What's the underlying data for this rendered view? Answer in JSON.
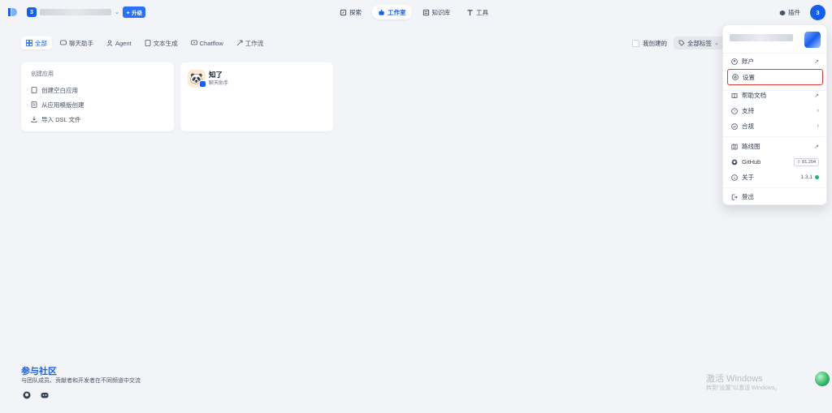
{
  "header": {
    "workspace_badge": "3",
    "upgrade_label": "升级",
    "nav": [
      {
        "label": "探索",
        "icon": "explore-icon"
      },
      {
        "label": "工作室",
        "icon": "studio-icon",
        "active": true
      },
      {
        "label": "知识库",
        "icon": "knowledge-icon"
      },
      {
        "label": "工具",
        "icon": "tools-icon"
      }
    ],
    "plugins_label": "插件",
    "avatar_label": "3"
  },
  "filters": {
    "tabs": [
      {
        "label": "全部",
        "active": true
      },
      {
        "label": "聊天助手"
      },
      {
        "label": "Agent"
      },
      {
        "label": "文本生成"
      },
      {
        "label": "Chatflow"
      },
      {
        "label": "工作流"
      }
    ],
    "mine_label": "我创建的",
    "tags_label": "全部标签"
  },
  "create_card": {
    "title": "创建应用",
    "items": [
      "创建空白应用",
      "从应用模版创建",
      "导入 DSL 文件"
    ]
  },
  "app_card": {
    "name": "知了",
    "type": "聊天助手"
  },
  "dropdown": {
    "account": "账户",
    "settings": "设置",
    "help_docs": "帮助文档",
    "support": "支持",
    "compliance": "合规",
    "roadmap": "路线图",
    "github": "GitHub",
    "github_stars": "☆ 81,204",
    "about": "关于",
    "version": "1.3.1",
    "logout": "登出"
  },
  "community": {
    "title": "参与社区",
    "description": "与团队成员、贡献者和开发者在不同频道中交流"
  },
  "watermark": {
    "line1": "激活 Windows",
    "line2": "转到\"设置\"以激活 Windows。"
  },
  "colors": {
    "accent": "#155eef",
    "highlight_border": "#e53935",
    "status_online": "#12b76a"
  }
}
